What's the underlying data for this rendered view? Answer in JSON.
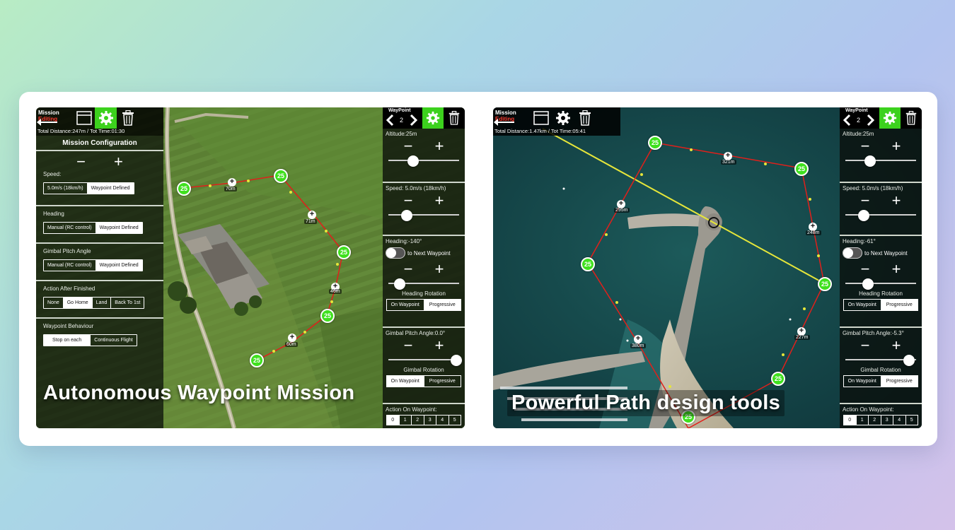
{
  "left": {
    "caption": "Autonomous Waypoint Mission",
    "toolbar": {
      "mission_label": "Mission",
      "editing_label": "Editing",
      "total_line": "Total Distance:247m / Tot Time:01:30"
    },
    "config": {
      "title": "Mission Configuration",
      "speed": {
        "label": "Speed:",
        "options": [
          "5.0m/s (18km/h)",
          "Waypoint Defined"
        ],
        "selected": 1
      },
      "heading": {
        "label": "Heading",
        "options": [
          "Manual (RC control)",
          "Waypoint Defined"
        ],
        "selected": 1
      },
      "gimbal": {
        "label": "Gimbal Pitch Angle",
        "options": [
          "Manual (RC control)",
          "Waypoint Defined"
        ],
        "selected": 1
      },
      "after": {
        "label": "Action After Finished",
        "options": [
          "None",
          "Go Home",
          "Land",
          "Back To 1st"
        ],
        "selected": 1
      },
      "behaviour": {
        "label": "Waypoint Behaviour",
        "options": [
          "Stop on each",
          "Continuous Flight"
        ],
        "selected": 0
      }
    },
    "waypoint_panel": {
      "header": "WayPoint",
      "number": "2",
      "altitude": "Altitude:25m",
      "speed": "Speed: 5.0m/s (18km/h)",
      "heading": "Heading:-140°",
      "toggle_label": "to Next Waypoint",
      "heading_rotation": "Heading Rotation",
      "rotation_options": [
        "On Waypoint",
        "Progressive"
      ],
      "gimbal_pitch": "Gimbal Pitch Angle:0.0°",
      "gimbal_rotation": "Gimbal Rotation",
      "gimbal_options": [
        "On Waypoint",
        "Progressive"
      ],
      "action": "Action On Waypoint:",
      "action_numbers": [
        "0",
        "1",
        "2",
        "3",
        "4",
        "5"
      ]
    },
    "map": {
      "waypoints": [
        "25",
        "25",
        "25",
        "25",
        "25"
      ],
      "distances": [
        "70m",
        "71m",
        "46m",
        "60m"
      ],
      "street": "Via Santa C..."
    }
  },
  "right": {
    "caption": "Powerful Path design tools",
    "toolbar": {
      "mission_label": "Mission",
      "editing_label": "Editing",
      "total_line": "Total Distance:1.47km / Tot Time:05:41"
    },
    "waypoint_panel": {
      "header": "WayPoint",
      "number": "2",
      "altitude": "Altitude:25m",
      "speed": "Speed: 5.0m/s (18km/h)",
      "heading": "Heading:-61°",
      "toggle_label": "to Next Waypoint",
      "heading_rotation": "Heading Rotation",
      "rotation_options": [
        "On Waypoint",
        "Progressive"
      ],
      "gimbal_pitch": "Gimbal Pitch Angle:-5.3°",
      "gimbal_rotation": "Gimbal Rotation",
      "gimbal_options": [
        "On Waypoint",
        "Progressive"
      ],
      "action": "Action On Waypoint:",
      "action_numbers": [
        "0",
        "1",
        "2",
        "3",
        "4",
        "5"
      ]
    },
    "map": {
      "waypoints": [
        "25",
        "25",
        "25",
        "25",
        "25",
        "25"
      ],
      "distances": [
        "321m",
        "295m",
        "248m",
        "227m",
        "380m"
      ]
    }
  },
  "colors": {
    "accent_green": "#3cd11d",
    "path_red": "#e0201b",
    "path_yellow": "#e6e63a",
    "editing_red": "#ff3b30"
  },
  "icons": [
    "gear-icon",
    "trash-icon",
    "photo-icon",
    "back-arrow-icon",
    "chevron-left-icon",
    "chevron-right-icon"
  ]
}
